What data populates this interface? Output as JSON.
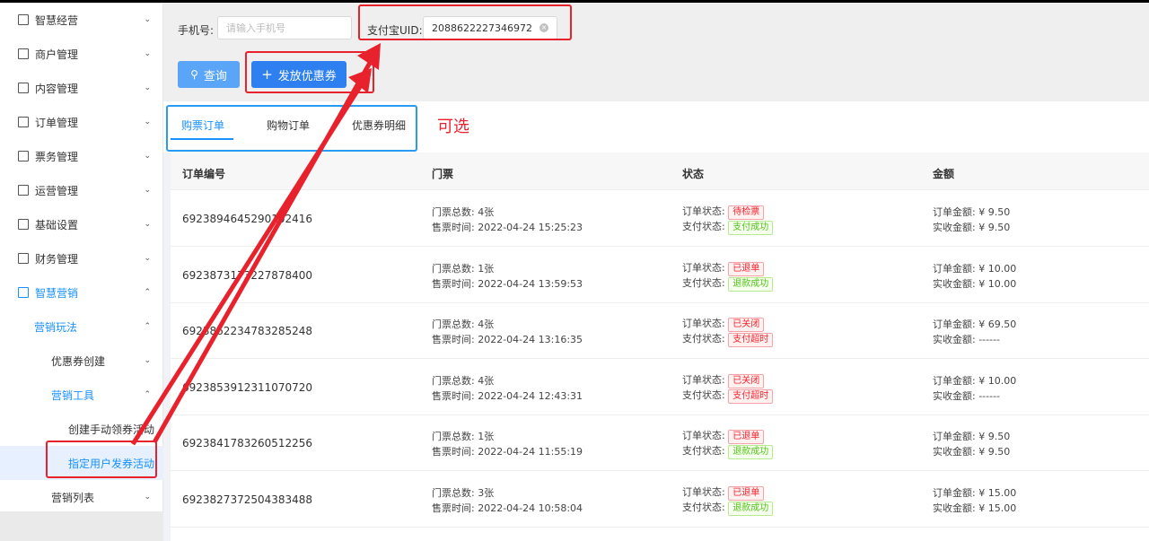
{
  "sidebar": {
    "items": [
      {
        "label": "智慧经营",
        "arrow": "⌄"
      },
      {
        "label": "商户管理",
        "arrow": "⌄"
      },
      {
        "label": "内容管理",
        "arrow": "⌄"
      },
      {
        "label": "订单管理",
        "arrow": "⌄"
      },
      {
        "label": "票务管理",
        "arrow": "⌄"
      },
      {
        "label": "运营管理",
        "arrow": "⌄"
      },
      {
        "label": "基础设置",
        "arrow": "⌄"
      },
      {
        "label": "财务管理",
        "arrow": "⌄"
      },
      {
        "label": "智慧营销",
        "arrow": "⌃"
      },
      {
        "label": "营销玩法",
        "arrow": "⌃"
      },
      {
        "label": "优惠券创建",
        "arrow": "⌄"
      },
      {
        "label": "营销工具",
        "arrow": "⌃"
      },
      {
        "label": "创建手动领券活动",
        "arrow": ""
      },
      {
        "label": "指定用户发券活动",
        "arrow": ""
      },
      {
        "label": "营销列表",
        "arrow": "⌄"
      }
    ]
  },
  "filters": {
    "phone_label": "手机号:",
    "phone_placeholder": "请输入手机号",
    "uid_label": "支付宝UID:",
    "uid_value": "2088622227346972",
    "clear_icon": "×",
    "query_icon": "⚲",
    "query_label": "查询",
    "issue_icon": "+",
    "issue_label": "发放优惠券"
  },
  "tabs": [
    {
      "label": "购票订单"
    },
    {
      "label": "购物订单"
    },
    {
      "label": "优惠券明细"
    }
  ],
  "annotation": "可选",
  "table": {
    "headers": [
      "订单编号",
      "门票",
      "状态",
      "金额"
    ],
    "ticket_total_label": "门票总数:",
    "sale_time_label": "售票时间:",
    "order_status_label": "订单状态:",
    "pay_status_label": "支付状态:",
    "order_amount_label": "订单金额:",
    "received_amount_label": "实收金额:",
    "rows": [
      {
        "id": "6923894645290102416",
        "tickets": "4张",
        "time": "2022-04-24 15:25:23",
        "order_status": "待检票",
        "pay_status": "支付成功",
        "order_amount": "¥ 9.50",
        "received": "¥ 9.50"
      },
      {
        "id": "6923873173227878400",
        "tickets": "1张",
        "time": "2022-04-24 13:59:53",
        "order_status": "已退单",
        "pay_status": "退款成功",
        "order_amount": "¥ 10.00",
        "received": "¥ 10.00"
      },
      {
        "id": "6923862234783285248",
        "tickets": "4张",
        "time": "2022-04-24 13:16:35",
        "order_status": "已关闭",
        "pay_status": "支付超时",
        "order_amount": "¥ 69.50",
        "received": "------"
      },
      {
        "id": "6923853912311070720",
        "tickets": "4张",
        "time": "2022-04-24 12:43:31",
        "order_status": "已关闭",
        "pay_status": "支付超时",
        "order_amount": "¥ 10.00",
        "received": "------"
      },
      {
        "id": "6923841783260512256",
        "tickets": "1张",
        "time": "2022-04-24 11:55:19",
        "order_status": "已退单",
        "pay_status": "退款成功",
        "order_amount": "¥ 9.50",
        "received": "¥ 9.50"
      },
      {
        "id": "6923827372504383488",
        "tickets": "3张",
        "time": "2022-04-24 10:58:04",
        "order_status": "已退单",
        "pay_status": "退款成功",
        "order_amount": "¥ 15.00",
        "received": "¥ 15.00"
      }
    ]
  },
  "colors": {
    "primary": "#1890ff",
    "annotation_red": "#e8222d",
    "annotation_blue": "#2a9bf0"
  }
}
